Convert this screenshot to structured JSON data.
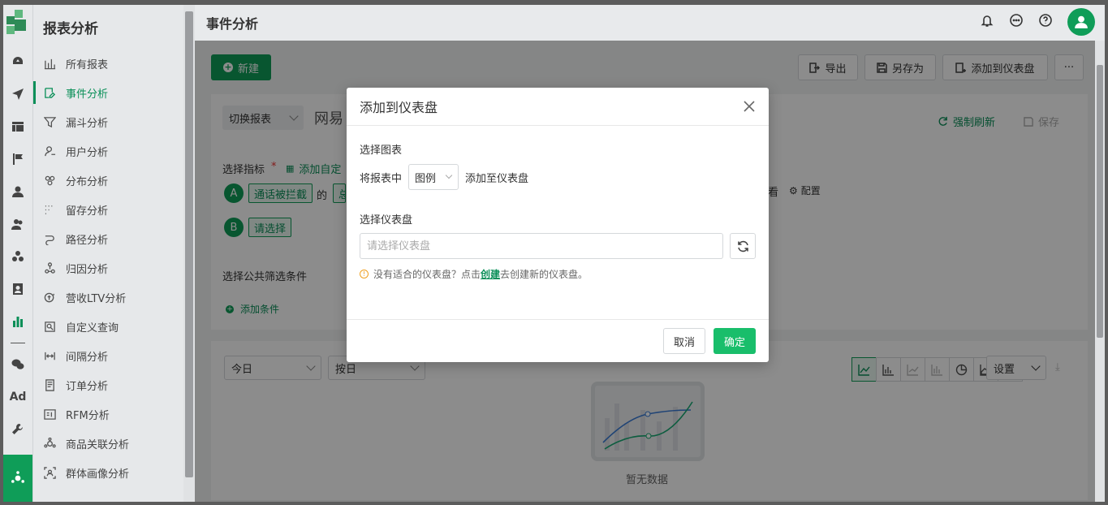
{
  "nav": {
    "title": "报表分析",
    "items": [
      {
        "label": "所有报表",
        "icon": "bar-chart-icon"
      },
      {
        "label": "事件分析",
        "icon": "edit-icon",
        "active": true
      },
      {
        "label": "漏斗分析",
        "icon": "funnel-icon"
      },
      {
        "label": "用户分析",
        "icon": "user-icon"
      },
      {
        "label": "分布分析",
        "icon": "distribution-icon"
      },
      {
        "label": "留存分析",
        "icon": "retention-icon"
      },
      {
        "label": "路径分析",
        "icon": "path-icon"
      },
      {
        "label": "归因分析",
        "icon": "attribution-icon"
      },
      {
        "label": "营收LTV分析",
        "icon": "revenue-icon"
      },
      {
        "label": "自定义查询",
        "icon": "query-icon"
      },
      {
        "label": "间隔分析",
        "icon": "interval-icon"
      },
      {
        "label": "订单分析",
        "icon": "order-icon"
      },
      {
        "label": "RFM分析",
        "icon": "rfm-icon"
      },
      {
        "label": "商品关联分析",
        "icon": "product-link-icon"
      },
      {
        "label": "群体画像分析",
        "icon": "persona-icon"
      }
    ]
  },
  "rail": {
    "ad_label": "Ad"
  },
  "topbar": {
    "title": "事件分析"
  },
  "toolbar": {
    "new_label": "新建",
    "export_label": "导出",
    "save_as_label": "另存为",
    "add_to_dashboard_label": "添加到仪表盘",
    "more_label": "···"
  },
  "report": {
    "switch_label": "切换报表",
    "name_partial": "网易",
    "force_refresh_label": "强制刷新",
    "save_label": "保存",
    "metric_label": "选择指标",
    "required_mark": "*",
    "add_custom_label": "添加自定",
    "metric_a_letter": "A",
    "metric_a_event": "通话被拦截",
    "metric_a_of": "的",
    "metric_a_partial": "总",
    "metric_b_letter": "B",
    "metric_b_placeholder": "请选择",
    "view_partial": "看",
    "config_label": "配置",
    "filter_label": "选择公共筛选条件",
    "add_condition_label": "添加条件"
  },
  "chart_panel": {
    "date_select": "今日",
    "granularity_select": "按日",
    "settings_label": "设置",
    "numeric_icon_label": "123",
    "empty_text": "暂无数据"
  },
  "modal": {
    "title": "添加到仪表盘",
    "select_chart_label": "选择图表",
    "row_prefix": "将报表中",
    "chart_select_value": "图例",
    "row_suffix": "添加至仪表盘",
    "select_dashboard_label": "选择仪表盘",
    "dashboard_placeholder": "请选择仪表盘",
    "hint_before": "没有适合的仪表盘？点击",
    "hint_link": "创建",
    "hint_after": "去创建新的仪表盘。",
    "cancel_label": "取消",
    "ok_label": "确定"
  },
  "colors": {
    "primary": "#0f9d58",
    "ok_button": "#19be6b",
    "warn": "#f0a020"
  }
}
